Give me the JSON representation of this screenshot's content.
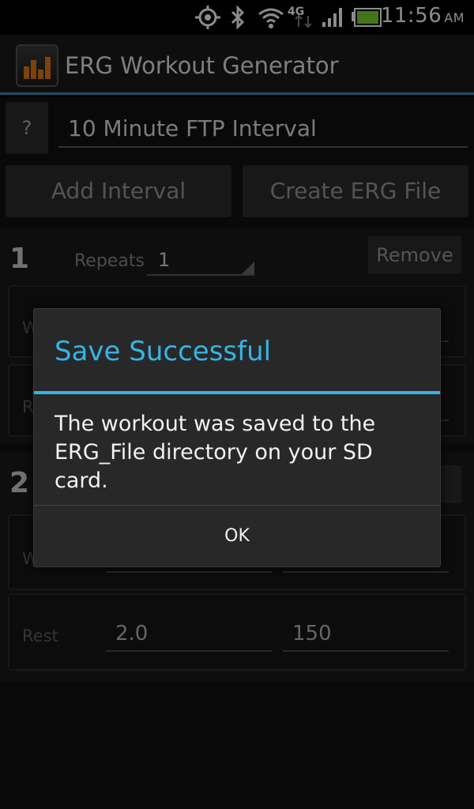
{
  "status_bar": {
    "time": "11:56",
    "ampm": "AM",
    "network": "4G",
    "icons": [
      "gps-icon",
      "bluetooth-icon",
      "wifi-icon",
      "network-4g-icon",
      "signal-icon",
      "battery-icon"
    ]
  },
  "app": {
    "title": "ERG Workout Generator"
  },
  "form": {
    "help_label": "?",
    "workout_name": "10 Minute FTP Interval",
    "add_interval_label": "Add Interval",
    "create_file_label": "Create ERG File"
  },
  "intervals": [
    {
      "number": "1",
      "repeats_label": "Repeats",
      "repeats_value": "1",
      "remove_label": "Remove",
      "work_label": "W",
      "rest_label": "R"
    },
    {
      "number": "2",
      "remove_label": "e",
      "work_label": "W",
      "rest_label": "Rest",
      "rest_duration": "2.0",
      "rest_power": "150"
    }
  ],
  "dialog": {
    "title": "Save Successful",
    "message": "The workout was saved to the ERG_File directory on your SD card.",
    "ok_label": "OK"
  },
  "colors": {
    "accent": "#33b5e5",
    "titlebar_rule": "#2b8fc0",
    "background": "#121212",
    "battery": "#7cd32c"
  }
}
